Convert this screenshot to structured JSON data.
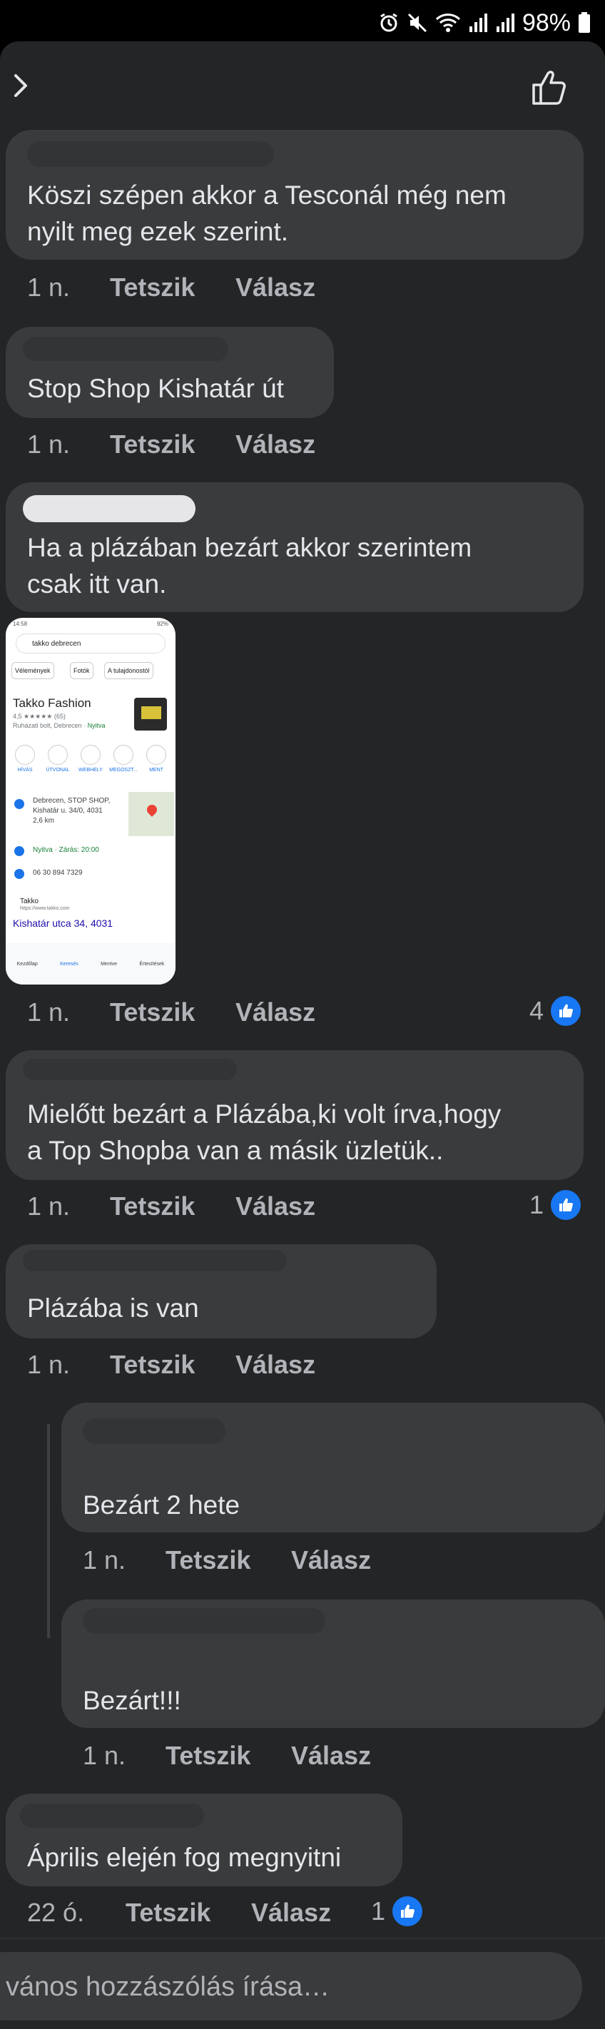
{
  "status_bar": {
    "battery_text": "98%"
  },
  "comments": [
    {
      "text_lines": [
        "Köszi szépen akkor a Tesconál még nem",
        "nyilt meg ezek szerint."
      ],
      "time": "1 n.",
      "like": "Tetszik",
      "reply": "Válasz"
    },
    {
      "text_lines": [
        "Stop Shop Kishatár út"
      ],
      "time": "1 n.",
      "like": "Tetszik",
      "reply": "Válasz"
    },
    {
      "text_lines": [
        "Ha a plázában bezárt akkor szerintem",
        "csak itt van."
      ],
      "time": "1 n.",
      "like": "Tetszik",
      "reply": "Válasz",
      "reactions": "4",
      "attachment": {
        "search_query": "takko debrecen",
        "chips": [
          "Vélemények",
          "Fotók",
          "A tulajdonostól"
        ],
        "business_name": "Takko Fashion",
        "rating_text": "4,5 ★★★★★ (65)",
        "category_text": "Ruházati bolt, Debrecen",
        "status_open": "Nyitva",
        "actions": [
          "HÍVÁS",
          "ÚTVONAL",
          "WEBHELY",
          "MEGOSZT...",
          "MENT"
        ],
        "address_lines": [
          "Debrecen, STOP SHOP,",
          "Kishatár u. 34/0, 4031",
          "2,6 km"
        ],
        "hours_text": "Nyitva · Zárás: 20:00",
        "phone_text": "06 30 894 7329",
        "site_name": "Takko",
        "site_url": "https://www.takko.com",
        "site_link": "Kishatár utca 34, 4031",
        "nav": [
          "Kezdőlap",
          "Keresés",
          "Mentve",
          "Értesítések"
        ]
      }
    },
    {
      "text_lines": [
        "Mielőtt bezárt a Plázába,ki volt írva,hogy",
        "a Top Shopba van a másik üzletük.."
      ],
      "time": "1 n.",
      "like": "Tetszik",
      "reply": "Válasz",
      "reactions": "1"
    },
    {
      "text_lines": [
        "Plázába is van"
      ],
      "time": "1 n.",
      "like": "Tetszik",
      "reply": "Válasz"
    },
    {
      "text_lines": [
        "Bezárt 2 hete"
      ],
      "time": "1 n.",
      "like": "Tetszik",
      "reply": "Válasz"
    },
    {
      "text_lines": [
        "Bezárt!!!"
      ],
      "time": "1 n.",
      "like": "Tetszik",
      "reply": "Válasz"
    },
    {
      "text_lines": [
        "Április elején fog megnyitni"
      ],
      "time": "22 ó.",
      "like": "Tetszik",
      "reply": "Válasz",
      "reactions": "1"
    }
  ],
  "composer": {
    "placeholder": "vános hozzászólás írása…"
  },
  "colors": {
    "background": "#242526",
    "bubble": "#3a3b3c",
    "text": "#e4e6eb",
    "meta": "#b0b3b8",
    "like_blue": "#1877f2"
  }
}
